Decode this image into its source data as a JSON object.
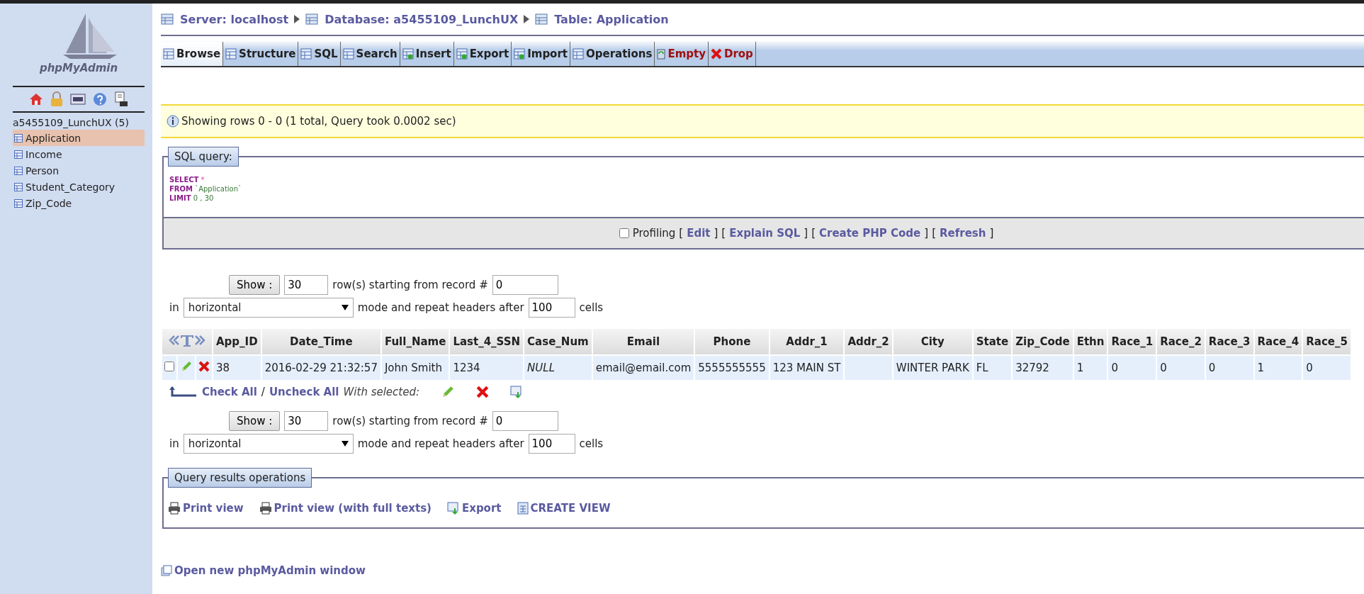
{
  "sidebar": {
    "logo": "phpMyAdmin",
    "database": "a5455109_LunchUX (5)",
    "tables": [
      {
        "label": "Application",
        "selected": true
      },
      {
        "label": "Income",
        "selected": false
      },
      {
        "label": "Person",
        "selected": false
      },
      {
        "label": "Student_Category",
        "selected": false
      },
      {
        "label": "Zip_Code",
        "selected": false
      }
    ]
  },
  "breadcrumb": [
    {
      "label": "Server: localhost"
    },
    {
      "label": "Database: a5455109_LunchUX"
    },
    {
      "label": "Table: Application"
    }
  ],
  "tabs": [
    {
      "label": "Browse",
      "selected": true,
      "kind": "normal"
    },
    {
      "label": "Structure",
      "selected": false,
      "kind": "normal"
    },
    {
      "label": "SQL",
      "selected": false,
      "kind": "normal"
    },
    {
      "label": "Search",
      "selected": false,
      "kind": "normal"
    },
    {
      "label": "Insert",
      "selected": false,
      "kind": "normal"
    },
    {
      "label": "Export",
      "selected": false,
      "kind": "normal"
    },
    {
      "label": "Import",
      "selected": false,
      "kind": "normal"
    },
    {
      "label": "Operations",
      "selected": false,
      "kind": "normal"
    },
    {
      "label": "Empty",
      "selected": false,
      "kind": "danger"
    },
    {
      "label": "Drop",
      "selected": false,
      "kind": "danger"
    }
  ],
  "notice": "Showing rows 0 - 0 (1 total, Query took 0.0002 sec)",
  "sql_query": {
    "legend": "SQL query:",
    "lines": [
      {
        "keyword": "SELECT",
        "rest": "*"
      },
      {
        "keyword": "FROM",
        "rest": "`Application`"
      },
      {
        "keyword": "LIMIT",
        "rest": "0 , 30"
      }
    ],
    "profiling": {
      "label": "Profiling",
      "checked": false
    },
    "links": [
      {
        "open": "[",
        "label": "Edit",
        "close": "]"
      },
      {
        "open": "[",
        "label": "Explain SQL",
        "close": "]"
      },
      {
        "open": "[",
        "label": "Create PHP Code",
        "close": "]"
      },
      {
        "open": "[",
        "label": "Refresh",
        "close": "]"
      }
    ]
  },
  "nav_top": {
    "show_button": "Show :",
    "rows": "30",
    "rows_label": "row(s) starting from record #",
    "start": "0",
    "in_label": "in",
    "mode": "horizontal",
    "repeat_label": "mode and repeat headers after",
    "repeat": "100",
    "cells_label": "cells"
  },
  "table": {
    "columns": [
      "App_ID",
      "Date_Time",
      "Full_Name",
      "Last_4_SSN",
      "Case_Num",
      "Email",
      "Phone",
      "Addr_1",
      "Addr_2",
      "City",
      "State",
      "Zip_Code",
      "Ethn",
      "Race_1",
      "Race_2",
      "Race_3",
      "Race_4",
      "Race_5"
    ],
    "rows": [
      {
        "checked": false,
        "cells": [
          {
            "text": "38",
            "kind": "value"
          },
          {
            "text": "2016-02-29 21:32:57",
            "kind": "value"
          },
          {
            "text": "John Smith",
            "kind": "value"
          },
          {
            "text": "1234",
            "kind": "value"
          },
          {
            "text": "NULL",
            "kind": "null"
          },
          {
            "text": "email@email.com",
            "kind": "value"
          },
          {
            "text": "5555555555",
            "kind": "value"
          },
          {
            "text": "123 MAIN ST",
            "kind": "value"
          },
          {
            "kind": "empty"
          },
          {
            "text": "WINTER PARK",
            "kind": "value"
          },
          {
            "text": "FL",
            "kind": "value"
          },
          {
            "text": "32792",
            "kind": "value"
          },
          {
            "text": "1",
            "kind": "value"
          },
          {
            "text": "0",
            "kind": "value"
          },
          {
            "text": "0",
            "kind": "value"
          },
          {
            "text": "0",
            "kind": "value"
          },
          {
            "text": "1",
            "kind": "value"
          },
          {
            "text": "0",
            "kind": "value"
          }
        ]
      }
    ]
  },
  "bulk": {
    "check_all": "Check All",
    "separator": "/",
    "uncheck_all": "Uncheck All",
    "with_selected": "With selected:"
  },
  "nav_bottom": {
    "show_button": "Show :",
    "rows": "30",
    "rows_label": "row(s) starting from record #",
    "start": "0",
    "in_label": "in",
    "mode": "horizontal",
    "repeat_label": "mode and repeat headers after",
    "repeat": "100",
    "cells_label": "cells"
  },
  "results_ops": {
    "legend": "Query results operations",
    "links": [
      {
        "label": "Print view",
        "kind": "print"
      },
      {
        "label": "Print view (with full texts)",
        "kind": "print"
      },
      {
        "label": "Export",
        "kind": "export"
      },
      {
        "label": "CREATE VIEW",
        "kind": "view"
      }
    ]
  },
  "footer_link": "Open new phpMyAdmin window"
}
